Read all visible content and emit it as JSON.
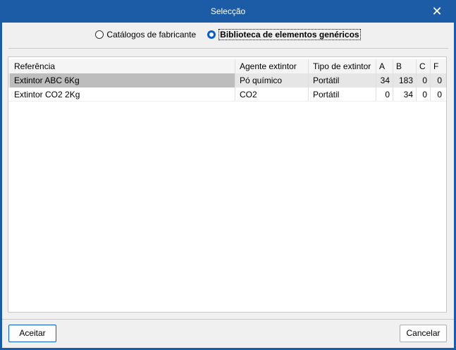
{
  "window": {
    "title": "Selecção",
    "close": "✕"
  },
  "source": {
    "options": [
      "Catálogos de fabricante",
      "Biblioteca de elementos genéricos"
    ],
    "selected": 1
  },
  "table": {
    "headers": [
      "Referência",
      "Agente extintor",
      "Tipo de extintor",
      "A",
      "B",
      "C",
      "F"
    ],
    "rows": [
      [
        "Extintor ABC 6Kg",
        "Pó químico",
        "Portátil",
        "34",
        "183",
        "0",
        "0"
      ],
      [
        "Extintor CO2 2Kg",
        "CO2",
        "Portátil",
        "0",
        "34",
        "0",
        "0"
      ]
    ],
    "selected_row": 0
  },
  "buttons": {
    "accept": "Aceitar",
    "cancel": "Cancelar"
  }
}
